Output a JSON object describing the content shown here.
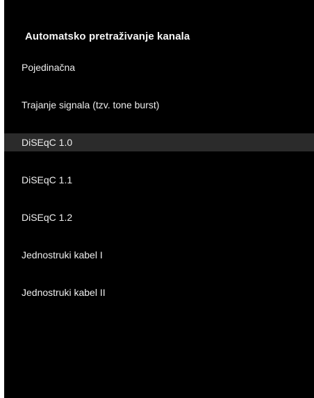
{
  "header": {
    "title": "Automatsko pretraživanje kanala"
  },
  "menu": {
    "selected_index": 2,
    "items": [
      {
        "label": "Pojedinačna"
      },
      {
        "label": "Trajanje signala (tzv. tone burst)"
      },
      {
        "label": "DiSEqC 1.0"
      },
      {
        "label": "DiSEqC 1.1"
      },
      {
        "label": "DiSEqC 1.2"
      },
      {
        "label": "Jednostruki kabel I"
      },
      {
        "label": "Jednostruki kabel II"
      }
    ]
  },
  "colors": {
    "background": "#000000",
    "highlight": "#2b2b2b",
    "text": "#eeeeee"
  }
}
